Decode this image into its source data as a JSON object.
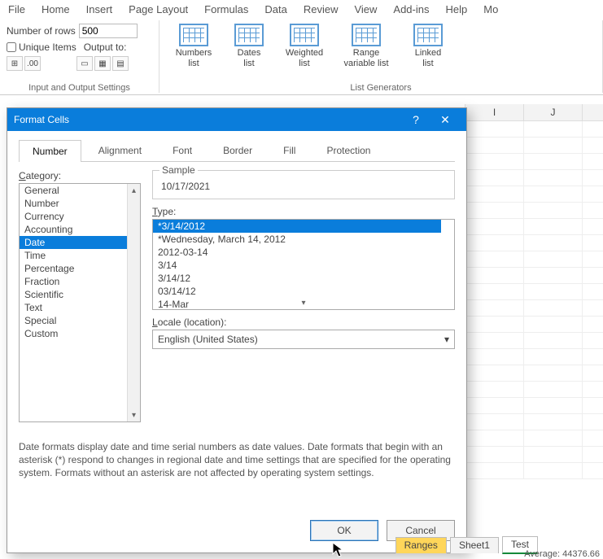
{
  "ribbon": {
    "tabs": [
      "File",
      "Home",
      "Insert",
      "Page Layout",
      "Formulas",
      "Data",
      "Review",
      "View",
      "Add-ins",
      "Help",
      "Mo"
    ],
    "numRowsLabel": "Number of rows",
    "numRowsValue": "500",
    "uniqueItems": "Unique Items",
    "outputTo": "Output to:",
    "group1Label": "Input and Output Settings",
    "group2Label": "List Generators",
    "generators": [
      {
        "line1": "Numbers",
        "line2": "list"
      },
      {
        "line1": "Dates",
        "line2": "list"
      },
      {
        "line1": "Weighted",
        "line2": "list"
      },
      {
        "line1": "Range",
        "line2": "variable list"
      },
      {
        "line1": "Linked",
        "line2": "list"
      }
    ]
  },
  "gridCols": [
    "I",
    "J"
  ],
  "dialog": {
    "title": "Format Cells",
    "tabs": [
      "Number",
      "Alignment",
      "Font",
      "Border",
      "Fill",
      "Protection"
    ],
    "activeTab": 0,
    "categoryLabel": "Category:",
    "categories": [
      "General",
      "Number",
      "Currency",
      "Accounting",
      "Date",
      "Time",
      "Percentage",
      "Fraction",
      "Scientific",
      "Text",
      "Special",
      "Custom"
    ],
    "selectedCategory": 4,
    "sampleLabel": "Sample",
    "sampleValue": "10/17/2021",
    "typeLabel": "Type:",
    "types": [
      "*3/14/2012",
      "*Wednesday, March 14, 2012",
      "2012-03-14",
      "3/14",
      "3/14/12",
      "03/14/12",
      "14-Mar"
    ],
    "selectedType": 0,
    "localeLabel": "Locale (location):",
    "localeValue": "English (United States)",
    "description": "Date formats display date and time serial numbers as date values.  Date formats that begin with an asterisk (*) respond to changes in regional date and time settings that are specified for the operating system. Formats without an asterisk are not affected by operating system settings.",
    "ok": "OK",
    "cancel": "Cancel"
  },
  "sheets": {
    "tabs": [
      {
        "label": "Ranges",
        "class": "highlight"
      },
      {
        "label": "Sheet1",
        "class": ""
      },
      {
        "label": "Test",
        "class": "active"
      }
    ]
  },
  "status": {
    "average": "Average: 44376.66"
  }
}
